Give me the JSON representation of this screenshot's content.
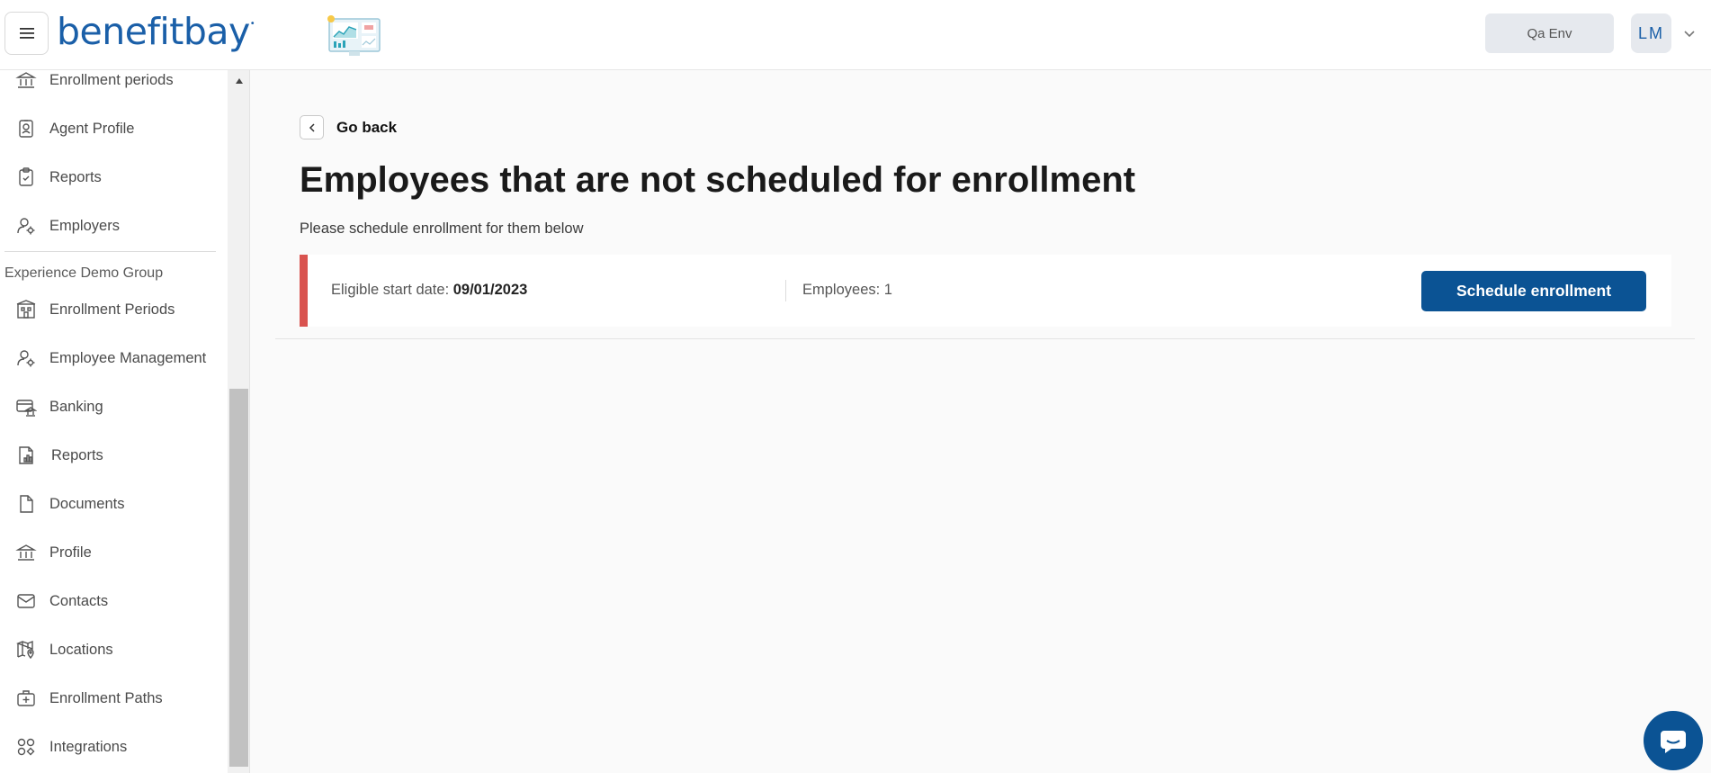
{
  "header": {
    "logo_text": "benefitbay",
    "logo_mark": "•",
    "environment_label": "Qa Env",
    "user_initials": "LM"
  },
  "sidebar": {
    "items_top": [
      {
        "label": "Enrollment periods",
        "icon": "bank-icon"
      },
      {
        "label": "Agent Profile",
        "icon": "id-badge-icon"
      },
      {
        "label": "Reports",
        "icon": "clipboard-check-icon"
      },
      {
        "label": "Employers",
        "icon": "user-gear-icon"
      }
    ],
    "section_title": "Experience Demo Group",
    "items_group": [
      {
        "label": "Enrollment Periods",
        "icon": "building-icon"
      },
      {
        "label": "Employee Management",
        "icon": "user-gear-icon"
      },
      {
        "label": "Banking",
        "icon": "bank-card-icon"
      },
      {
        "label": "Reports",
        "icon": "report-chart-icon"
      },
      {
        "label": "Documents",
        "icon": "document-icon"
      },
      {
        "label": "Profile",
        "icon": "bank-icon"
      },
      {
        "label": "Contacts",
        "icon": "envelope-icon"
      },
      {
        "label": "Locations",
        "icon": "map-pin-icon"
      },
      {
        "label": "Enrollment Paths",
        "icon": "medical-bag-icon"
      },
      {
        "label": "Integrations",
        "icon": "apps-icon"
      }
    ]
  },
  "main": {
    "go_back_label": "Go back",
    "title": "Employees that are not scheduled for enrollment",
    "subtitle": "Please schedule enrollment for them below",
    "card": {
      "start_label": "Eligible start date: ",
      "start_value": "09/01/2023",
      "employees_label": "Employees: 1",
      "button_label": "Schedule enrollment"
    }
  },
  "colors": {
    "brand": "#1a5fa8",
    "button": "#0b5394",
    "accent_alert": "#d9534f"
  }
}
